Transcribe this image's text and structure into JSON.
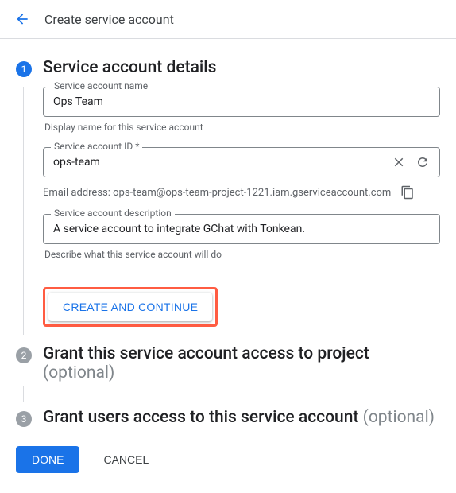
{
  "header": {
    "title": "Create service account"
  },
  "step1": {
    "number": "1",
    "title": "Service account details",
    "name_field": {
      "label": "Service account name",
      "value": "Ops Team",
      "helper": "Display name for this service account"
    },
    "id_field": {
      "label": "Service account ID *",
      "value": "ops-team"
    },
    "email": "Email address: ops-team@ops-team-project-1221.iam.gserviceaccount.com",
    "desc_field": {
      "label": "Service account description",
      "value": "A service account to integrate GChat with Tonkean.",
      "helper": "Describe what this service account will do"
    },
    "create_button": "CREATE AND CONTINUE"
  },
  "step2": {
    "number": "2",
    "title": "Grant this service account access to project",
    "optional": "(optional)"
  },
  "step3": {
    "number": "3",
    "title": "Grant users access to this service account",
    "optional": "(optional)"
  },
  "footer": {
    "done": "DONE",
    "cancel": "CANCEL"
  }
}
